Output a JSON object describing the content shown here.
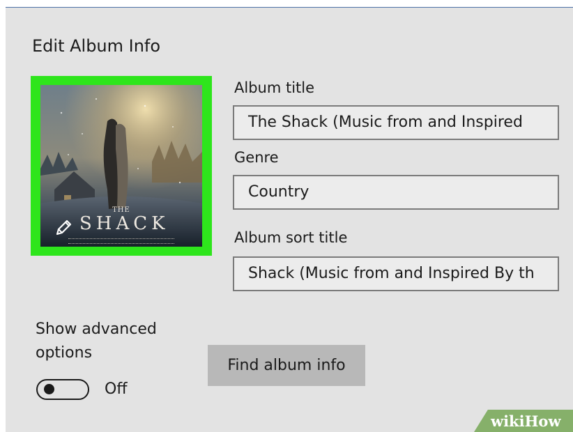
{
  "dialog": {
    "title": "Edit Album Info"
  },
  "album_art": {
    "small_text": "THE",
    "title_text": "SHACK",
    "edit_icon": "pencil-icon"
  },
  "fields": {
    "album_title": {
      "label": "Album title",
      "value": "The Shack (Music from and Inspired"
    },
    "genre": {
      "label": "Genre",
      "value": "Country"
    },
    "album_sort_title": {
      "label": "Album sort title",
      "value": "Shack (Music from and Inspired By th"
    }
  },
  "advanced": {
    "label_line1": "Show advanced",
    "label_line2": "options",
    "toggle_state": "Off"
  },
  "buttons": {
    "find_album_info": "Find album info"
  },
  "watermark": {
    "part1": "wiki",
    "part2": "How"
  },
  "colors": {
    "dialog_bg": "#e3e3e3",
    "highlight_frame": "#2ee51c",
    "field_border": "#7a7a7a",
    "button_bg": "#b8b8b8",
    "watermark_bg": "#86b06a"
  }
}
